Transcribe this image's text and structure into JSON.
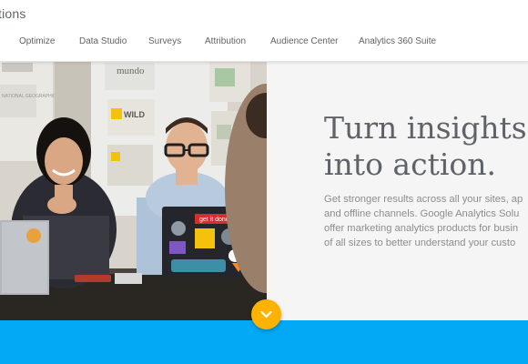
{
  "header": {
    "brand": "tions",
    "nav": [
      {
        "label": "Optimize"
      },
      {
        "label": "Data Studio"
      },
      {
        "label": "Surveys"
      },
      {
        "label": "Attribution"
      },
      {
        "label": "Audience Center"
      },
      {
        "label": "Analytics 360 Suite"
      }
    ]
  },
  "hero": {
    "headline_line1": "Turn insights",
    "headline_line2": "into action.",
    "desc_lines": [
      "Get stronger results across all your sites, ap",
      "and offline channels. Google Analytics Solu",
      "offer marketing analytics products for busin",
      "of all sizes to better understand your custo"
    ],
    "photo_signs": {
      "mundo": "mundo",
      "wild": "WILD",
      "natgeo": "NATIONAL GEOGRAPHIC",
      "laptop_sticker": "get it done."
    }
  },
  "scroll_icon": "chevron-down-icon",
  "colors": {
    "band": "#03a9f4",
    "scroll_button": "#ffb300",
    "headline": "#5f6368"
  }
}
